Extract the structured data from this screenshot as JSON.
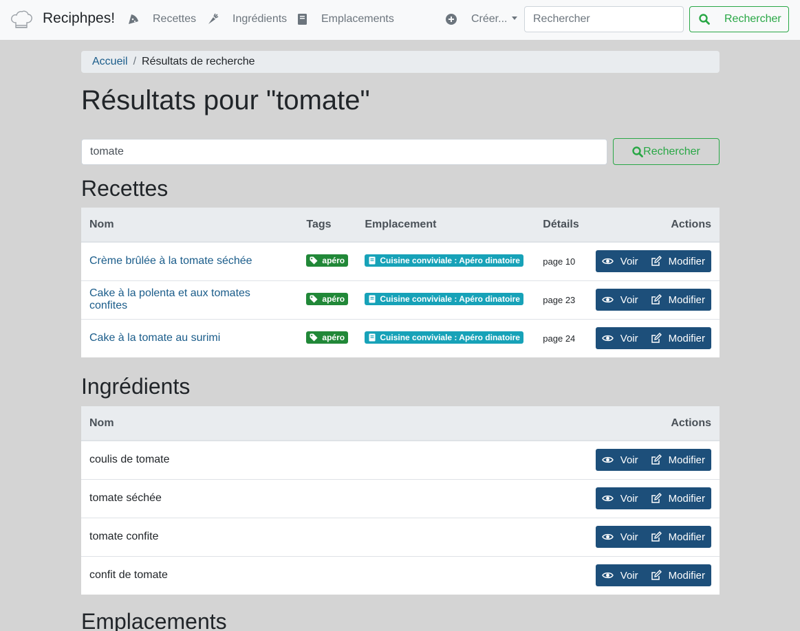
{
  "navbar": {
    "brand": "Reciphpes!",
    "links": [
      {
        "label": "Recettes",
        "icon": "pizza-slice-icon"
      },
      {
        "label": "Ingrédients",
        "icon": "carrot-icon"
      },
      {
        "label": "Emplacements",
        "icon": "book-icon"
      }
    ],
    "create_label": "Créer...",
    "search_placeholder": "Rechercher",
    "search_button": "Rechercher"
  },
  "breadcrumb": {
    "home": "Accueil",
    "current": "Résultats de recherche"
  },
  "page_title": "Résultats pour \"tomate\"",
  "search": {
    "value": "tomate",
    "button": "Rechercher"
  },
  "recettes": {
    "title": "Recettes",
    "headers": {
      "nom": "Nom",
      "tags": "Tags",
      "emplacement": "Emplacement",
      "details": "Détails",
      "actions": "Actions"
    },
    "rows": [
      {
        "nom": "Crème brûlée à la tomate séchée",
        "tag": "apéro",
        "emplacement": "Cuisine conviviale : Apéro dinatoire",
        "details": "page 10"
      },
      {
        "nom": "Cake à la polenta et aux tomates confites",
        "tag": "apéro",
        "emplacement": "Cuisine conviviale : Apéro dinatoire",
        "details": "page 23"
      },
      {
        "nom": "Cake à la tomate au surimi",
        "tag": "apéro",
        "emplacement": "Cuisine conviviale : Apéro dinatoire",
        "details": "page 24"
      }
    ]
  },
  "ingredients": {
    "title": "Ingrédients",
    "headers": {
      "nom": "Nom",
      "actions": "Actions"
    },
    "rows": [
      {
        "nom": "coulis de tomate"
      },
      {
        "nom": "tomate séchée"
      },
      {
        "nom": "tomate confite"
      },
      {
        "nom": "confit de tomate"
      }
    ]
  },
  "emplacements": {
    "title": "Emplacements"
  },
  "actions": {
    "voir": "Voir",
    "modifier": "Modifier"
  },
  "colors": {
    "navbar_bg": "#f8f9fa",
    "page_bg": "#d4d4d4",
    "success": "#28a745",
    "action_btn": "#1d4f7a",
    "tag_badge": "#218838",
    "location_badge": "#17a2b8",
    "link": "#1a5c8a"
  }
}
